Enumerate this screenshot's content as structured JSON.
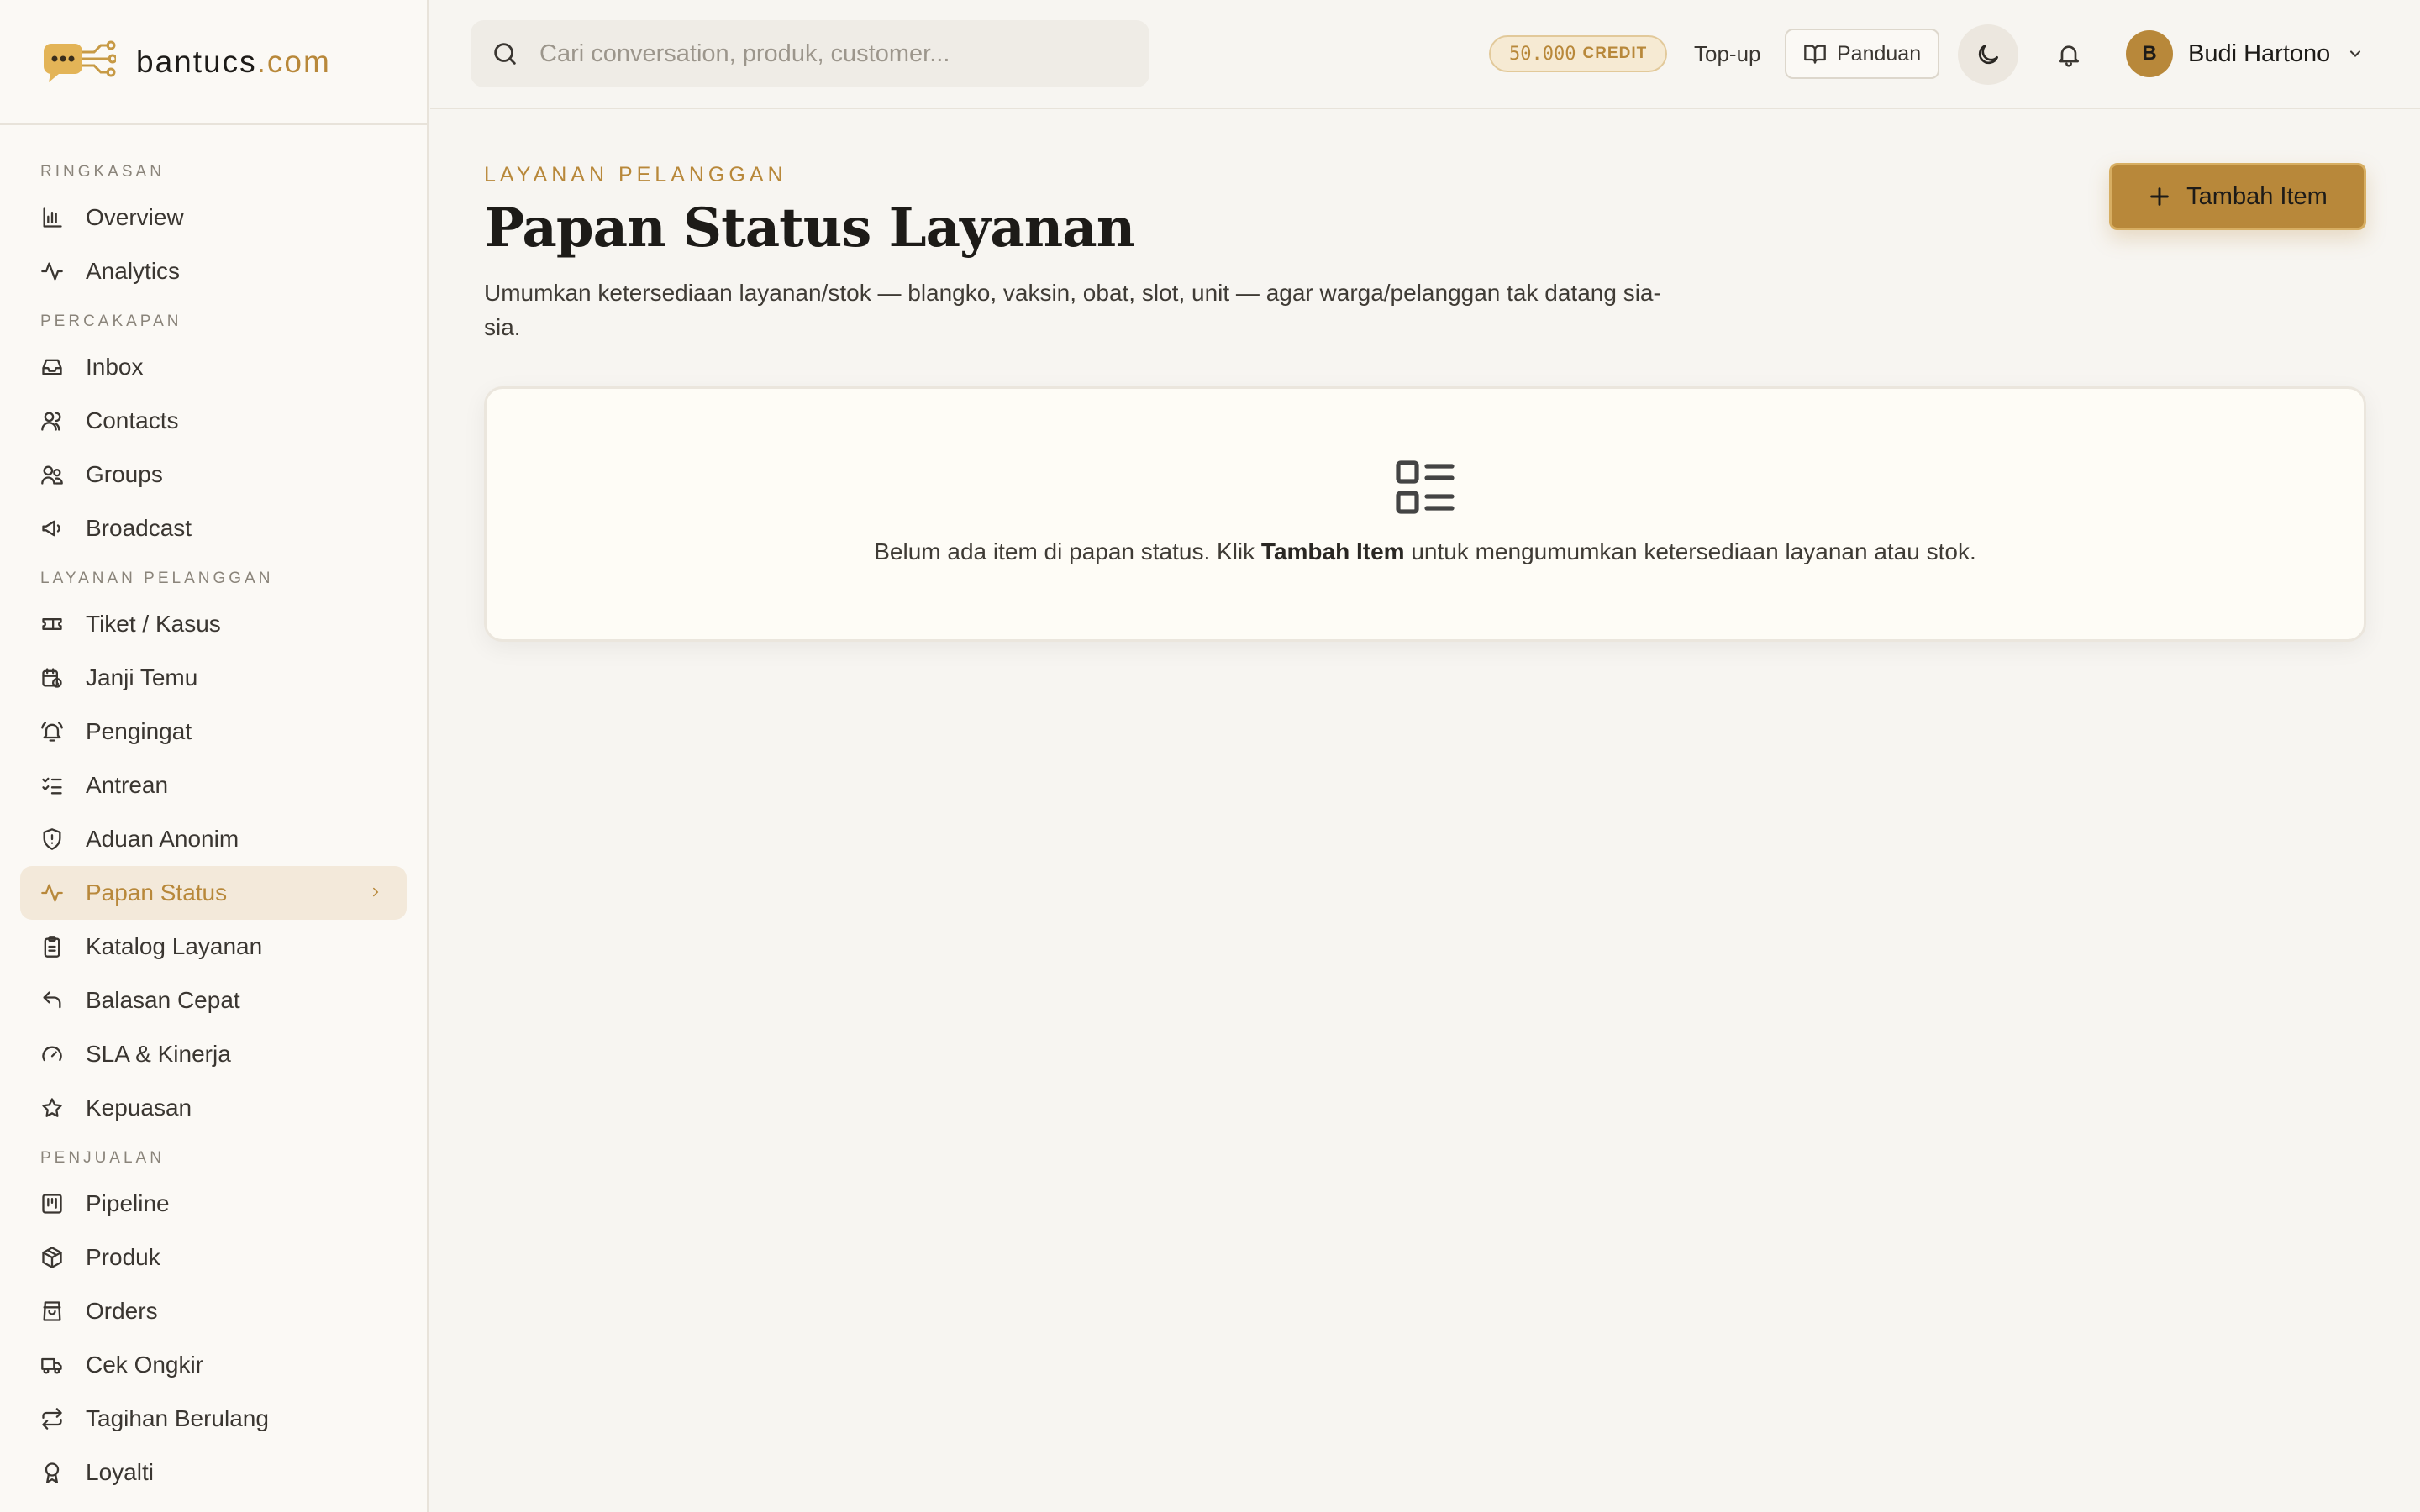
{
  "brand": {
    "name": "bantucs",
    "tld": ".com"
  },
  "sidebar": {
    "sections": [
      {
        "title": "RINGKASAN",
        "items": [
          {
            "label": "Overview",
            "icon": "bar-chart-icon"
          },
          {
            "label": "Analytics",
            "icon": "activity-icon"
          }
        ]
      },
      {
        "title": "PERCAKAPAN",
        "items": [
          {
            "label": "Inbox",
            "icon": "inbox-icon"
          },
          {
            "label": "Contacts",
            "icon": "contacts-icon"
          },
          {
            "label": "Groups",
            "icon": "groups-icon"
          },
          {
            "label": "Broadcast",
            "icon": "megaphone-icon"
          }
        ]
      },
      {
        "title": "LAYANAN PELANGGAN",
        "items": [
          {
            "label": "Tiket / Kasus",
            "icon": "ticket-icon"
          },
          {
            "label": "Janji Temu",
            "icon": "calendar-clock-icon"
          },
          {
            "label": "Pengingat",
            "icon": "bell-ring-icon"
          },
          {
            "label": "Antrean",
            "icon": "list-checks-icon"
          },
          {
            "label": "Aduan Anonim",
            "icon": "shield-alert-icon"
          },
          {
            "label": "Papan Status",
            "icon": "activity-icon",
            "active": true
          },
          {
            "label": "Katalog Layanan",
            "icon": "clipboard-icon"
          },
          {
            "label": "Balasan Cepat",
            "icon": "reply-icon"
          },
          {
            "label": "SLA & Kinerja",
            "icon": "gauge-icon"
          },
          {
            "label": "Kepuasan",
            "icon": "star-icon"
          }
        ]
      },
      {
        "title": "PENJUALAN",
        "items": [
          {
            "label": "Pipeline",
            "icon": "kanban-icon"
          },
          {
            "label": "Produk",
            "icon": "package-icon"
          },
          {
            "label": "Orders",
            "icon": "shopping-bag-icon"
          },
          {
            "label": "Cek Ongkir",
            "icon": "truck-icon"
          },
          {
            "label": "Tagihan Berulang",
            "icon": "repeat-icon"
          },
          {
            "label": "Loyalti",
            "icon": "award-icon"
          }
        ]
      }
    ]
  },
  "header": {
    "search_placeholder": "Cari conversation, produk, customer...",
    "credit_amount": "50.000",
    "credit_label": "CREDIT",
    "topup_label": "Top-up",
    "guide_label": "Panduan",
    "user": {
      "initial": "B",
      "name": "Budi Hartono"
    }
  },
  "main": {
    "eyebrow": "LAYANAN PELANGGAN",
    "title": "Papan Status Layanan",
    "description": "Umumkan ketersediaan layanan/stok — blangko, vaksin, obat, slot, unit — agar warga/pelanggan tak datang sia-sia.",
    "add_button_label": "Tambah Item",
    "empty_state": {
      "text_before": "Belum ada item di papan status. Klik ",
      "text_bold": "Tambah Item",
      "text_after": " untuk mengumumkan ketersediaan layanan atau stok."
    }
  },
  "colors": {
    "accent": "#b8883a",
    "background": "#f7f5f1",
    "sidebar_bg": "#fbf9f5",
    "active_bg": "#f3e9da",
    "card_bg": "#fefcf6"
  }
}
